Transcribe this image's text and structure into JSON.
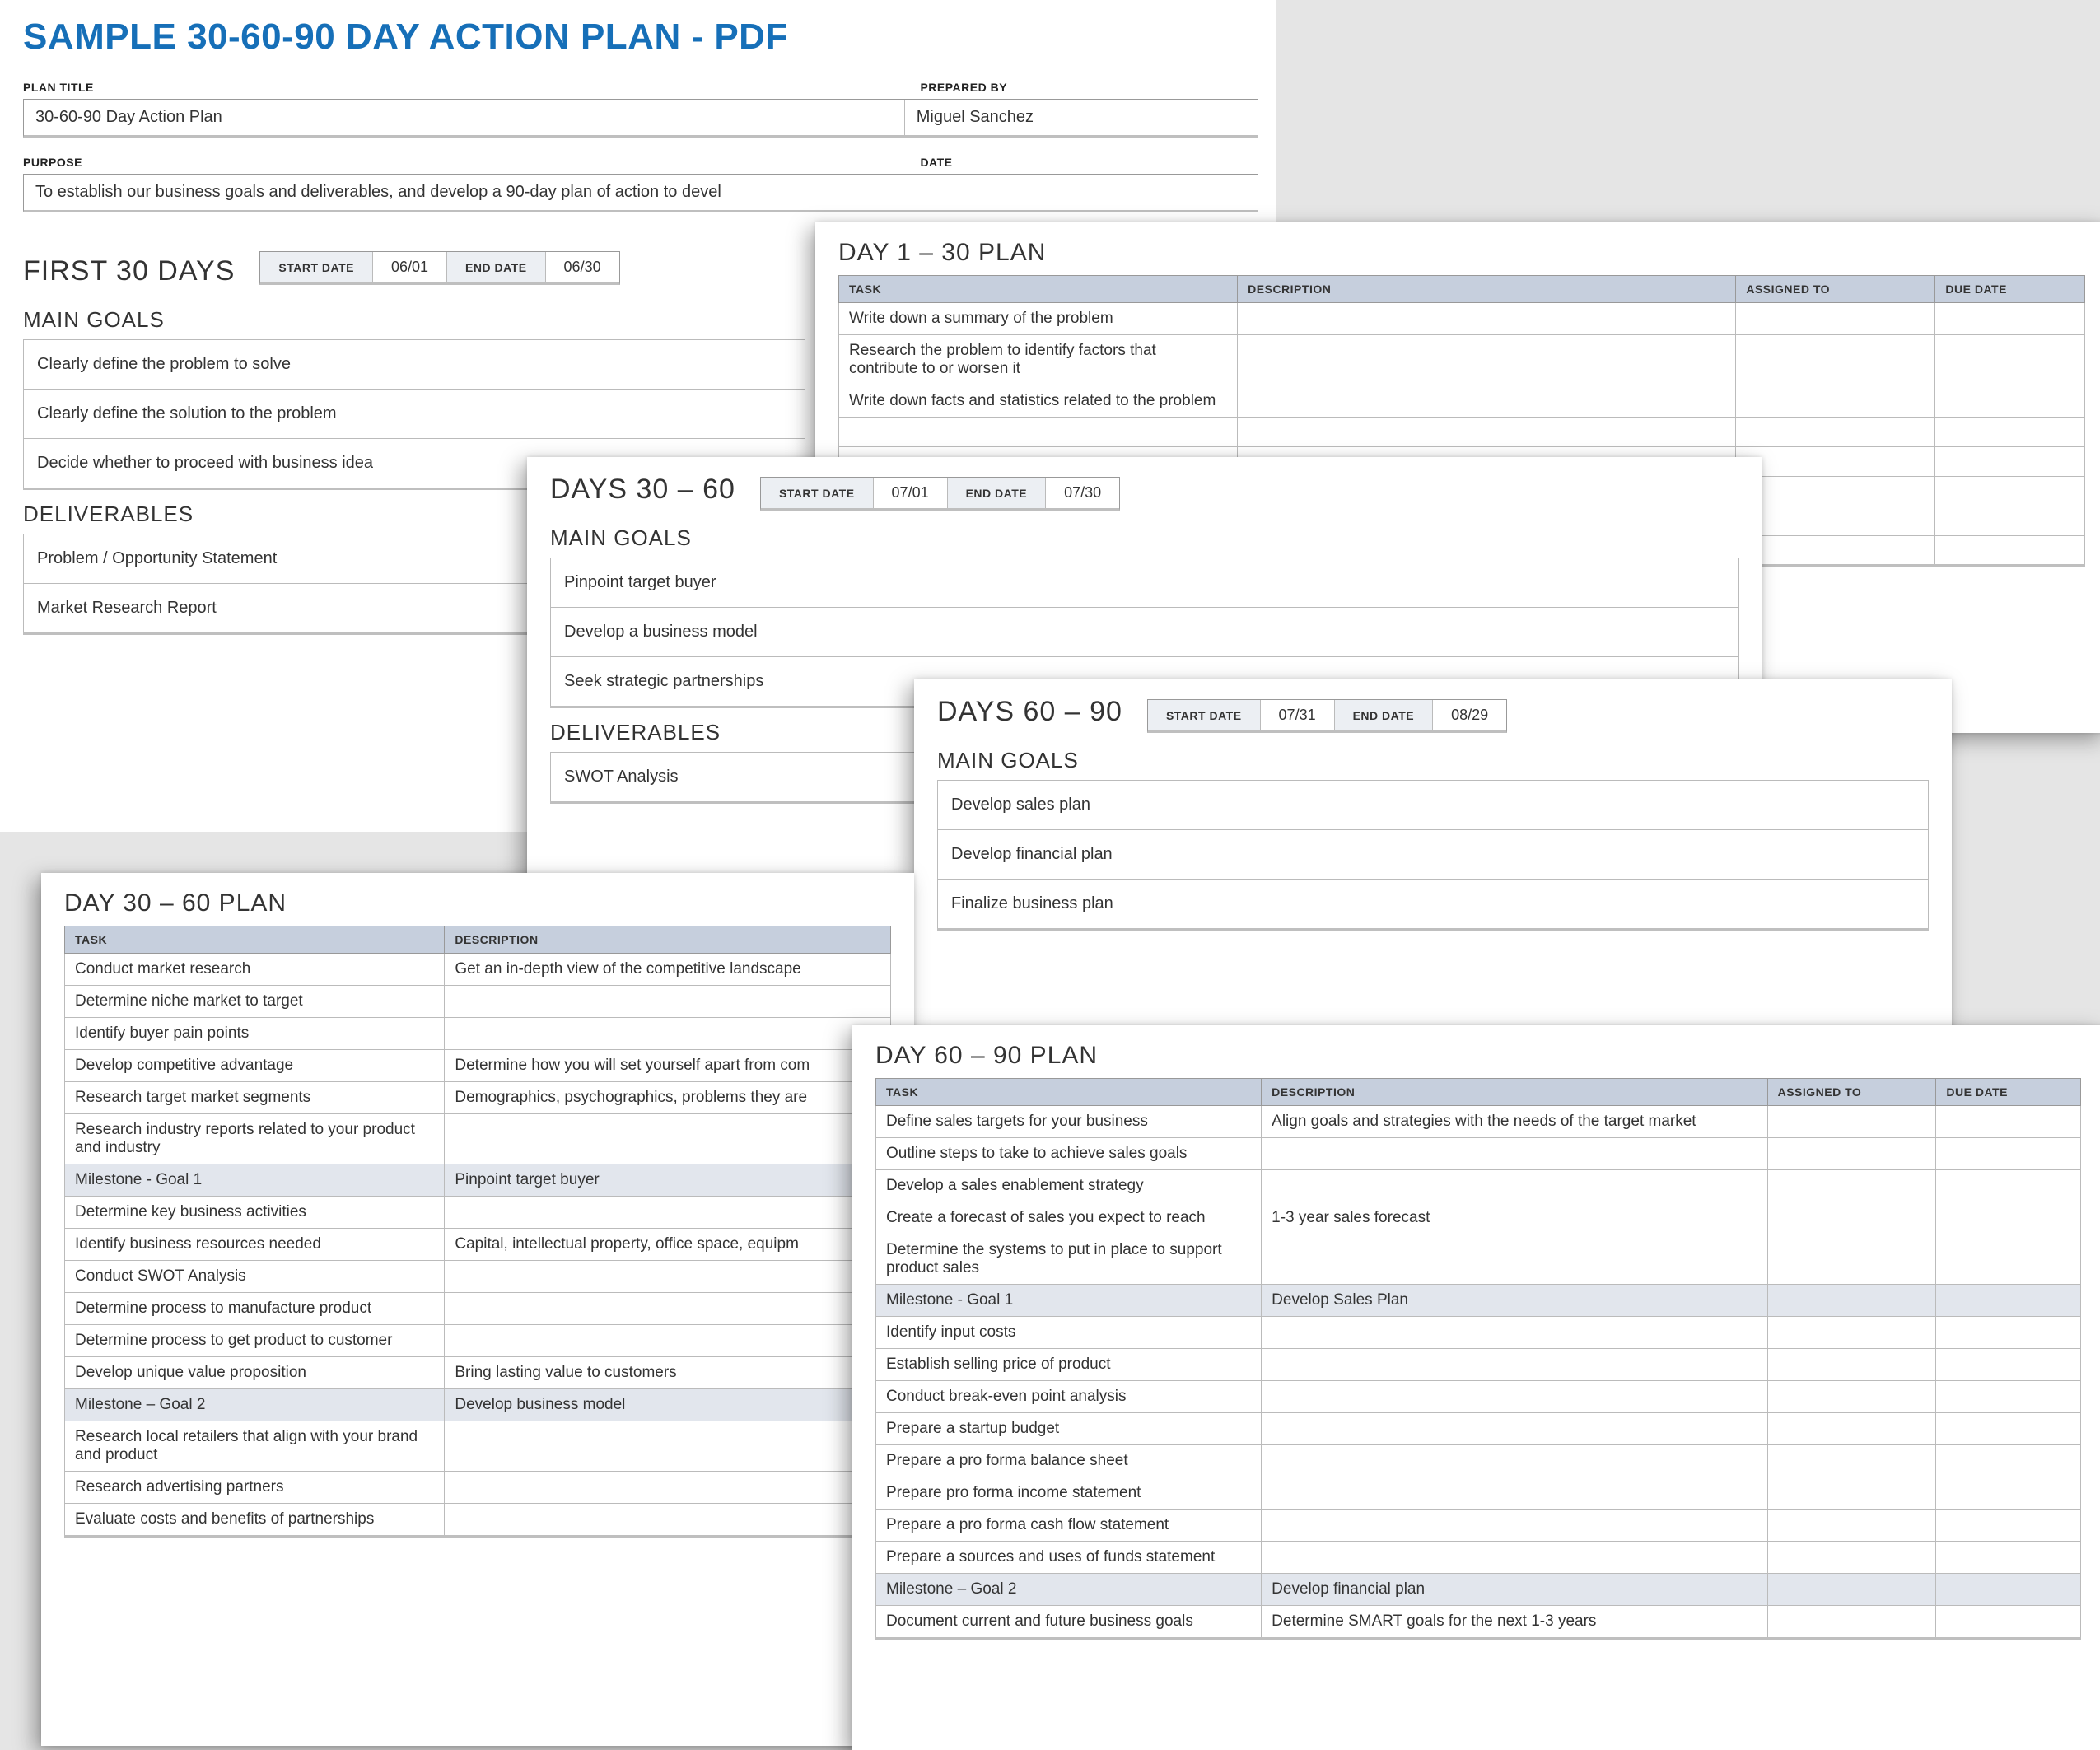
{
  "doc_title": "SAMPLE 30-60-90 DAY ACTION PLAN - PDF",
  "labels": {
    "plan_title": "PLAN TITLE",
    "prepared_by": "PREPARED BY",
    "purpose": "PURPOSE",
    "date": "DATE",
    "start_date": "START DATE",
    "end_date": "END DATE",
    "main_goals": "MAIN GOALS",
    "deliverables": "DELIVERABLES",
    "task": "TASK",
    "description": "DESCRIPTION",
    "assigned_to": "ASSIGNED TO",
    "due_date": "DUE DATE"
  },
  "header": {
    "plan_title": "30-60-90 Day Action Plan",
    "prepared_by": "Miguel Sanchez",
    "purpose": "To establish our business goals and deliverables, and develop a 90-day plan of action to devel"
  },
  "first30": {
    "title": "FIRST 30 DAYS",
    "start": "06/01",
    "end": "06/30",
    "goals": [
      "Clearly define the problem to solve",
      "Clearly define the solution to the problem",
      "Decide whether to proceed with business idea"
    ],
    "deliverables": [
      "Problem / Opportunity Statement",
      "Market Research Report"
    ]
  },
  "plan1_30": {
    "title": "DAY 1 – 30 PLAN",
    "rows": [
      {
        "task": "Write down a summary of the problem",
        "desc": ""
      },
      {
        "task": "Research the problem to identify factors that contribute to or worsen it",
        "desc": ""
      },
      {
        "task": "Write down facts and statistics related to the problem",
        "desc": ""
      }
    ]
  },
  "days30_60": {
    "title": "DAYS 30 – 60",
    "start": "07/01",
    "end": "07/30",
    "goals": [
      "Pinpoint target buyer",
      "Develop a business model",
      "Seek strategic partnerships"
    ],
    "deliverables": [
      "SWOT Analysis"
    ]
  },
  "days60_90": {
    "title": "DAYS 60 – 90",
    "start": "07/31",
    "end": "08/29",
    "goals": [
      "Develop sales plan",
      "Develop financial plan",
      "Finalize business plan"
    ]
  },
  "plan30_60": {
    "title": "DAY 30 – 60 PLAN",
    "rows": [
      {
        "task": "Conduct market research",
        "desc": "Get an in-depth view of the competitive landscape"
      },
      {
        "task": "Determine niche market to target",
        "desc": ""
      },
      {
        "task": "Identify buyer pain points",
        "desc": ""
      },
      {
        "task": "Develop competitive advantage",
        "desc": "Determine how you will set yourself apart from com"
      },
      {
        "task": "Research target market segments",
        "desc": "Demographics, psychographics, problems they are"
      },
      {
        "task": "Research industry reports related to your product and industry",
        "desc": ""
      },
      {
        "task": "Milestone - Goal 1",
        "desc": "Pinpoint target buyer",
        "milestone": true
      },
      {
        "task": "Determine key business activities",
        "desc": ""
      },
      {
        "task": "Identify business resources needed",
        "desc": "Capital, intellectual property, office space, equipm"
      },
      {
        "task": "Conduct SWOT Analysis",
        "desc": ""
      },
      {
        "task": "Determine process to manufacture product",
        "desc": ""
      },
      {
        "task": "Determine process to get product to customer",
        "desc": ""
      },
      {
        "task": "Develop unique value proposition",
        "desc": "Bring lasting value to customers"
      },
      {
        "task": "Milestone – Goal 2",
        "desc": "Develop business model",
        "milestone": true
      },
      {
        "task": "Research local retailers that align with your brand and product",
        "desc": ""
      },
      {
        "task": "Research advertising partners",
        "desc": ""
      },
      {
        "task": "Evaluate costs and benefits of partnerships",
        "desc": ""
      }
    ]
  },
  "plan60_90": {
    "title": "DAY 60 – 90 PLAN",
    "rows": [
      {
        "task": "Define sales targets for your business",
        "desc": "Align goals and strategies with the needs of the target market"
      },
      {
        "task": "Outline steps to take to achieve sales goals",
        "desc": ""
      },
      {
        "task": "Develop a sales enablement strategy",
        "desc": ""
      },
      {
        "task": "Create a forecast of sales you expect to reach",
        "desc": "1-3 year sales forecast"
      },
      {
        "task": "Determine the systems to put in place to support product sales",
        "desc": ""
      },
      {
        "task": "Milestone - Goal 1",
        "desc": "Develop Sales Plan",
        "milestone": true
      },
      {
        "task": "Identify input costs",
        "desc": ""
      },
      {
        "task": "Establish selling price of product",
        "desc": ""
      },
      {
        "task": "Conduct break-even point analysis",
        "desc": ""
      },
      {
        "task": "Prepare a startup budget",
        "desc": ""
      },
      {
        "task": "Prepare a pro forma balance sheet",
        "desc": ""
      },
      {
        "task": "Prepare pro forma income statement",
        "desc": ""
      },
      {
        "task": "Prepare a pro forma cash flow statement",
        "desc": ""
      },
      {
        "task": "Prepare a sources and uses of funds statement",
        "desc": ""
      },
      {
        "task": "Milestone – Goal 2",
        "desc": "Develop financial plan",
        "milestone": true
      },
      {
        "task": "Document current and future business goals",
        "desc": "Determine SMART goals for the next 1-3 years"
      }
    ]
  }
}
